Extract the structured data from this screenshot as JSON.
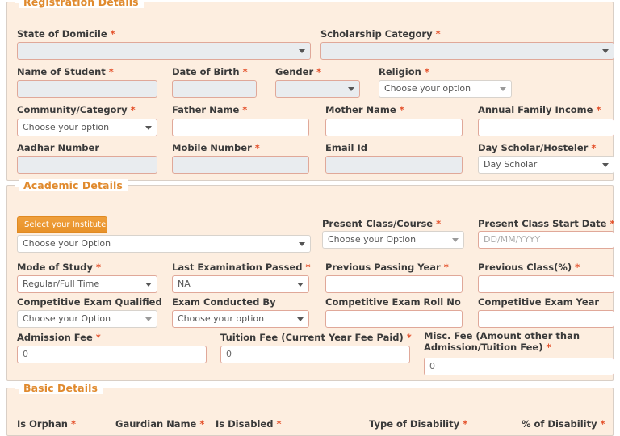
{
  "theme": {
    "panel_bg": "#fdeee0",
    "panel_border": "#d9cfc6",
    "legend_color": "#e08a2e",
    "required_color": "#e4502a",
    "input_border": "#e0a899",
    "input_disabled_bg": "#e9ecef",
    "accent_button": "#e8922a"
  },
  "sections": {
    "registration": {
      "legend": "Registration Details"
    },
    "academic": {
      "legend": "Academic Details"
    },
    "basic": {
      "legend": "Basic Details"
    }
  },
  "registration": {
    "state_of_domicile": {
      "label": "State of Domicile",
      "required": "*",
      "value": "",
      "type": "select"
    },
    "scholarship_category": {
      "label": "Scholarship Category",
      "required": "*",
      "value": "",
      "type": "select"
    },
    "name_of_student": {
      "label": "Name of Student",
      "required": "*",
      "value": "",
      "type": "text"
    },
    "date_of_birth": {
      "label": "Date of Birth",
      "required": "*",
      "value": "",
      "type": "text"
    },
    "gender": {
      "label": "Gender",
      "required": "*",
      "value": "",
      "type": "select"
    },
    "religion": {
      "label": "Religion",
      "required": "*",
      "value": "Choose your option",
      "type": "select"
    },
    "community_category": {
      "label": "Community/Category",
      "required": "*",
      "value": "Choose your option",
      "type": "select"
    },
    "father_name": {
      "label": "Father Name",
      "required": "*",
      "value": "",
      "type": "text"
    },
    "mother_name": {
      "label": "Mother Name",
      "required": "*",
      "value": "",
      "type": "text"
    },
    "annual_family_income": {
      "label": "Annual Family Income",
      "required": "*",
      "value": "",
      "type": "text"
    },
    "aadhar_number": {
      "label": "Aadhar Number",
      "required": "",
      "value": "",
      "type": "text"
    },
    "mobile_number": {
      "label": "Mobile Number",
      "required": "*",
      "value": "",
      "type": "text"
    },
    "email_id": {
      "label": "Email Id",
      "required": "",
      "value": "",
      "type": "text"
    },
    "day_scholar_hosteler": {
      "label": "Day Scholar/Hosteler",
      "required": "*",
      "value": "Day Scholar",
      "type": "select"
    }
  },
  "academic": {
    "select_institute_button": "Select your Institute",
    "institute": {
      "label": "",
      "required": "",
      "value": "Choose your Option",
      "type": "select"
    },
    "present_class_course": {
      "label": "Present Class/Course",
      "required": "*",
      "value": "Choose your Option",
      "type": "select"
    },
    "present_class_start_date": {
      "label": "Present Class Start Date",
      "required": "*",
      "value": "",
      "placeholder": "DD/MM/YYYY",
      "type": "text"
    },
    "mode_of_study": {
      "label": "Mode of Study",
      "required": "*",
      "value": "Regular/Full Time",
      "type": "select"
    },
    "last_examination_passed": {
      "label": "Last Examination Passed",
      "required": "*",
      "value": "NA",
      "type": "select"
    },
    "previous_passing_year": {
      "label": "Previous Passing Year",
      "required": "*",
      "value": "",
      "type": "text"
    },
    "previous_class_percent": {
      "label": "Previous Class(%)",
      "required": "*",
      "value": "",
      "type": "text"
    },
    "competitive_exam_qualified": {
      "label": "Competitive Exam Qualified",
      "required": "",
      "value": "Choose your Option",
      "type": "select"
    },
    "exam_conducted_by": {
      "label": "Exam Conducted By",
      "required": "",
      "value": "Choose your option",
      "type": "select"
    },
    "competitive_exam_roll_no": {
      "label": "Competitive Exam Roll No",
      "required": "",
      "value": "",
      "type": "text"
    },
    "competitive_exam_year": {
      "label": "Competitive Exam Year",
      "required": "",
      "value": "",
      "type": "text"
    },
    "admission_fee": {
      "label": "Admission Fee",
      "required": "*",
      "value": "0",
      "type": "text"
    },
    "tuition_fee": {
      "label": "Tuition Fee (Current Year Fee Paid)",
      "required": "*",
      "value": "0",
      "type": "text"
    },
    "misc_fee": {
      "label_line1": "Misc. Fee (Amount other than",
      "label_line2": "Admission/Tuition Fee)",
      "required": "*",
      "value": "0",
      "type": "text"
    }
  },
  "basic": {
    "is_orphan": {
      "label": "Is Orphan",
      "required": "*"
    },
    "gaurdian_name": {
      "label": "Gaurdian Name",
      "required": "*"
    },
    "is_disabled": {
      "label": "Is Disabled",
      "required": "*"
    },
    "type_of_disability": {
      "label": "Type of Disability",
      "required": "*"
    },
    "percent_of_disability": {
      "label": "% of Disability",
      "required": "*"
    }
  }
}
